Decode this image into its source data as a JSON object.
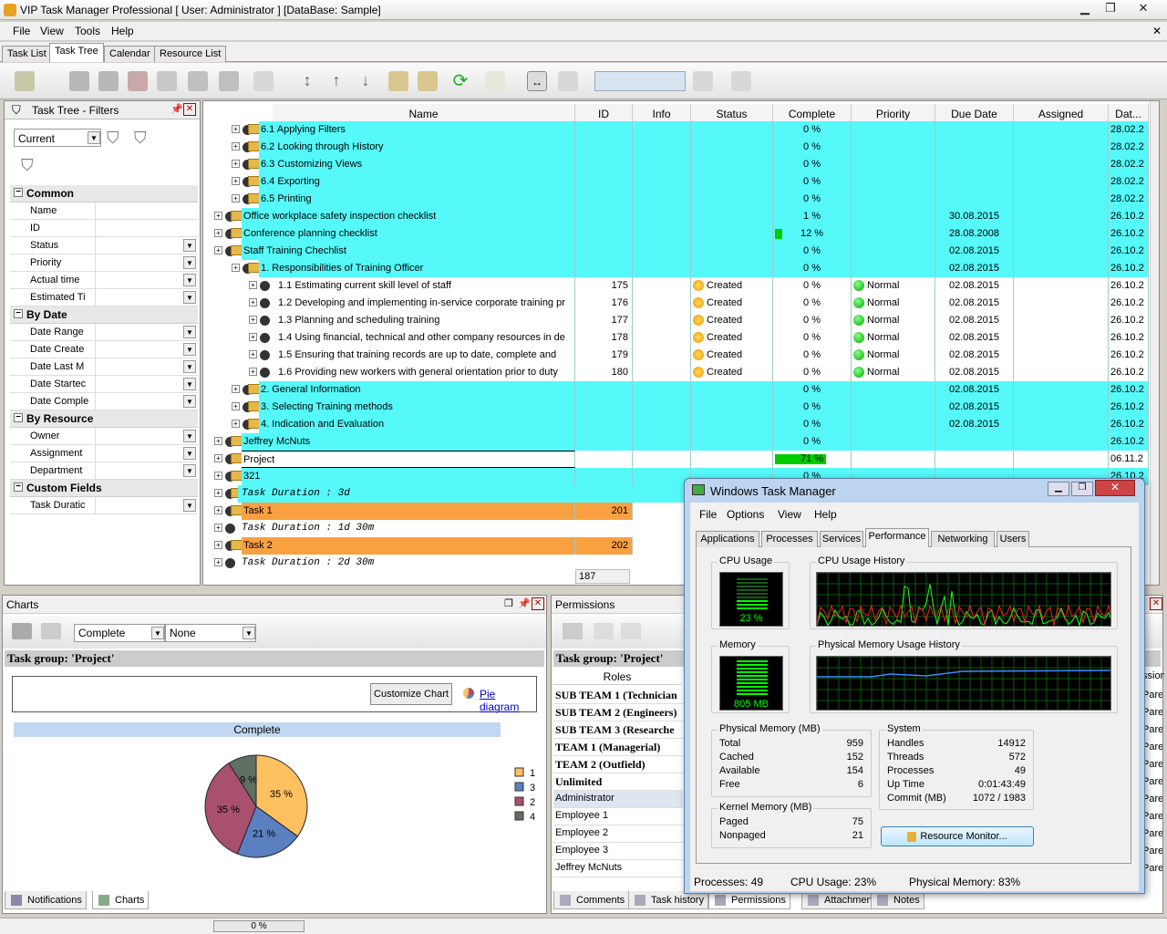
{
  "window": {
    "title": "VIP Task Manager Professional [ User: Administrator ] [DataBase: Sample]"
  },
  "menu": [
    "File",
    "View",
    "Tools",
    "Help"
  ],
  "tabs": [
    "Task List",
    "Task Tree",
    "Calendar",
    "Resource List"
  ],
  "filters": {
    "title": "Task Tree - Filters",
    "preset": "Current",
    "groups": {
      "common": "Common",
      "by_date": "By Date",
      "by_resource": "By Resource",
      "custom": "Custom Fields"
    },
    "rows": {
      "name": "Name",
      "id": "ID",
      "status": "Status",
      "priority": "Priority",
      "actual_time": "Actual time",
      "estimated": "Estimated Ti",
      "date_range": "Date Range",
      "date_created": "Date Create",
      "date_last": "Date Last M",
      "date_started": "Date Startec",
      "date_completed": "Date Comple",
      "owner": "Owner",
      "assignment": "Assignment",
      "department": "Department",
      "task_duration": "Task Duratic"
    }
  },
  "grid": {
    "columns": {
      "name": "Name",
      "id": "ID",
      "info": "Info",
      "status": "Status",
      "complete": "Complete",
      "priority": "Priority",
      "due": "Due Date",
      "assigned": "Assigned",
      "date": "Dat..."
    },
    "rows": [
      {
        "name": "6.1 Applying Filters",
        "id": "",
        "status": "",
        "complete": "0 %",
        "priority": "",
        "due": "",
        "date": "28.02.2"
      },
      {
        "name": "6.2 Looking through History",
        "id": "",
        "status": "",
        "complete": "0 %",
        "priority": "",
        "due": "",
        "date": "28.02.2"
      },
      {
        "name": "6.3 Customizing Views",
        "id": "",
        "status": "",
        "complete": "0 %",
        "priority": "",
        "due": "",
        "date": "28.02.2"
      },
      {
        "name": "6.4 Exporting",
        "id": "",
        "status": "",
        "complete": "0 %",
        "priority": "",
        "due": "",
        "date": "28.02.2"
      },
      {
        "name": "6.5 Printing",
        "id": "",
        "status": "",
        "complete": "0 %",
        "priority": "",
        "due": "",
        "date": "28.02.2"
      },
      {
        "name": "Office workplace safety inspection checklist",
        "id": "",
        "status": "",
        "complete": "1 %",
        "priority": "",
        "due": "30.08.2015",
        "date": "26.10.2"
      },
      {
        "name": "Conference planning checklist",
        "id": "",
        "status": "",
        "complete": "12 %",
        "priority": "",
        "due": "28.08.2008",
        "date": "26.10.2"
      },
      {
        "name": "Staff Training Chechlist",
        "id": "",
        "status": "",
        "complete": "0 %",
        "priority": "",
        "due": "02.08.2015",
        "date": "26.10.2"
      },
      {
        "name": "1. Responsibilities of Training Officer",
        "id": "",
        "status": "",
        "complete": "0 %",
        "priority": "",
        "due": "02.08.2015",
        "date": "26.10.2"
      },
      {
        "name": "1.1 Estimating current skill level of staff",
        "id": "175",
        "status": "Created",
        "complete": "0 %",
        "priority": "Normal",
        "due": "02.08.2015",
        "date": "26.10.2"
      },
      {
        "name": "1.2 Developing and implementing in-service corporate training pr",
        "id": "176",
        "status": "Created",
        "complete": "0 %",
        "priority": "Normal",
        "due": "02.08.2015",
        "date": "26.10.2"
      },
      {
        "name": "1.3 Planning and scheduling training",
        "id": "177",
        "status": "Created",
        "complete": "0 %",
        "priority": "Normal",
        "due": "02.08.2015",
        "date": "26.10.2"
      },
      {
        "name": "1.4 Using financial, technical and other company resources in de",
        "id": "178",
        "status": "Created",
        "complete": "0 %",
        "priority": "Normal",
        "due": "02.08.2015",
        "date": "26.10.2"
      },
      {
        "name": "1.5 Ensuring that training records are up to date, complete and",
        "id": "179",
        "status": "Created",
        "complete": "0 %",
        "priority": "Normal",
        "due": "02.08.2015",
        "date": "26.10.2"
      },
      {
        "name": "1.6 Providing new workers with general orientation prior to duty",
        "id": "180",
        "status": "Created",
        "complete": "0 %",
        "priority": "Normal",
        "due": "02.08.2015",
        "date": "26.10.2"
      },
      {
        "name": "2. General Information",
        "id": "",
        "status": "",
        "complete": "0 %",
        "priority": "",
        "due": "02.08.2015",
        "date": "26.10.2"
      },
      {
        "name": "3. Selecting Training methods",
        "id": "",
        "status": "",
        "complete": "0 %",
        "priority": "",
        "due": "02.08.2015",
        "date": "26.10.2"
      },
      {
        "name": "4. Indication and Evaluation",
        "id": "",
        "status": "",
        "complete": "0 %",
        "priority": "",
        "due": "02.08.2015",
        "date": "26.10.2"
      },
      {
        "name": "Jeffrey McNuts",
        "id": "",
        "status": "",
        "complete": "0 %",
        "priority": "",
        "due": "",
        "date": "26.10.2"
      },
      {
        "name": "Project",
        "id": "",
        "status": "",
        "complete": "71 %",
        "priority": "",
        "due": "",
        "date": "06.11.2"
      },
      {
        "name": "321",
        "id": "",
        "status": "",
        "complete": "0 %",
        "priority": "",
        "due": "",
        "date": "26.10.2"
      },
      {
        "name": "Task Duration : 3d",
        "id": "",
        "status": "",
        "complete": "",
        "priority": "",
        "due": "",
        "date": ""
      },
      {
        "name": "Task 1",
        "id": "201",
        "status": "",
        "complete": "",
        "priority": "",
        "due": "",
        "date": ""
      },
      {
        "name": "Task Duration : 1d 30m",
        "id": "",
        "status": "",
        "complete": "",
        "priority": "",
        "due": "",
        "date": ""
      },
      {
        "name": "Task 2",
        "id": "202",
        "status": "",
        "complete": "",
        "priority": "",
        "due": "",
        "date": ""
      },
      {
        "name": "Task Duration : 2d 30m",
        "id": "",
        "status": "",
        "complete": "",
        "priority": "",
        "due": "",
        "date": ""
      }
    ],
    "footer_count": "187"
  },
  "charts": {
    "title": "Charts",
    "select1": "Complete",
    "select2": "None",
    "group": "Task group: 'Project'",
    "customize": "Customize Chart",
    "pie_link": "Pie diagram",
    "bar_label": "Complete"
  },
  "chart_data": {
    "type": "pie",
    "title": "Complete",
    "slices": [
      {
        "label": "1",
        "value": 35,
        "color": "#ffc060"
      },
      {
        "label": "3",
        "value": 21,
        "color": "#5b80c0"
      },
      {
        "label": "2",
        "value": 35,
        "color": "#a8506e"
      },
      {
        "label": "4",
        "value": 9,
        "color": "#607060"
      }
    ],
    "legend": "right"
  },
  "permissions": {
    "title": "Permissions",
    "group": "Task group: 'Project'",
    "roles_header": "Roles",
    "roles": [
      "SUB TEAM 1 (Technician",
      "SUB TEAM 2 (Engineers)",
      "SUB TEAM 3 (Researche",
      "TEAM 1 (Managerial)",
      "TEAM 2 (Outfield)",
      "Unlimited",
      "Administrator",
      "Employee 1",
      "Employee 2",
      "Employee 3",
      "Jeffrey McNuts"
    ],
    "right_col_header": "ssions",
    "right_col": [
      "Pare",
      "Pare",
      "Pare",
      "Pare",
      "Pare",
      "Pare",
      "Pare",
      "Pare",
      "Pare",
      "Pare",
      "Pare"
    ]
  },
  "bottom_tabs_left": [
    "Notifications",
    "Charts"
  ],
  "bottom_tabs_right": [
    "Comments",
    "Task history",
    "Permissions",
    "Attachments",
    "Notes"
  ],
  "status": {
    "progress": "0 %"
  },
  "taskmgr": {
    "title": "Windows Task Manager",
    "menu": [
      "File",
      "Options",
      "View",
      "Help"
    ],
    "tabs": [
      "Applications",
      "Processes",
      "Services",
      "Performance",
      "Networking",
      "Users"
    ],
    "cpu_label": "CPU Usage",
    "cpu_value": "23 %",
    "cpu_history": "CPU Usage History",
    "mem_label": "Memory",
    "mem_value": "805 MB",
    "mem_history": "Physical Memory Usage History",
    "phys": {
      "label": "Physical Memory (MB)",
      "rows": [
        [
          "Total",
          "959"
        ],
        [
          "Cached",
          "152"
        ],
        [
          "Available",
          "154"
        ],
        [
          "Free",
          "6"
        ]
      ]
    },
    "sys": {
      "label": "System",
      "rows": [
        [
          "Handles",
          "14912"
        ],
        [
          "Threads",
          "572"
        ],
        [
          "Processes",
          "49"
        ],
        [
          "Up Time",
          "0:01:43:49"
        ],
        [
          "Commit (MB)",
          "1072 / 1983"
        ]
      ]
    },
    "kernel": {
      "label": "Kernel Memory (MB)",
      "rows": [
        [
          "Paged",
          "75"
        ],
        [
          "Nonpaged",
          "21"
        ]
      ]
    },
    "resmon": "Resource Monitor...",
    "status": {
      "processes": "Processes: 49",
      "cpu": "CPU Usage: 23%",
      "mem": "Physical Memory: 83%"
    }
  }
}
